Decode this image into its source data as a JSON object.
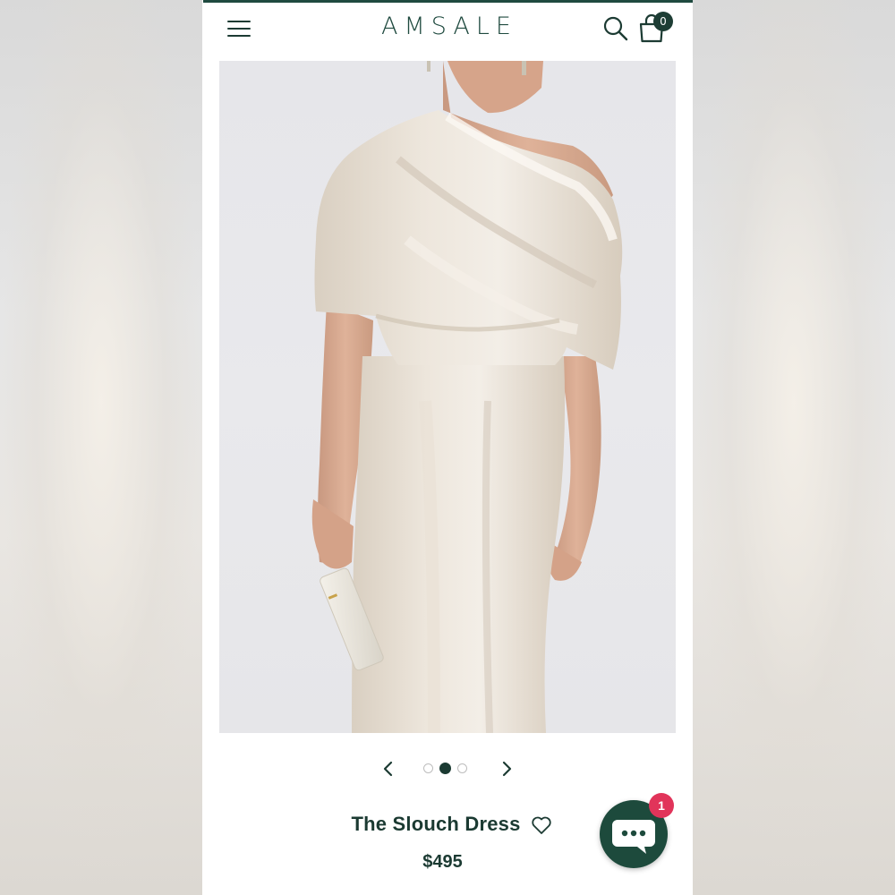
{
  "header": {
    "brand": "AMSALE",
    "cart_count": "0",
    "menu_icon": "hamburger-menu-icon",
    "search_icon": "search-icon",
    "cart_icon": "shopping-bag-icon"
  },
  "product": {
    "title": "The Slouch Dress",
    "price": "$495",
    "image_description_colors": {
      "background": "#e7e7ea",
      "dress": "#e6ddd1",
      "skin": "#d9a98c"
    }
  },
  "carousel": {
    "prev_icon": "chevron-left-icon",
    "next_icon": "chevron-right-icon",
    "total_slides": 3,
    "active_slide": 2
  },
  "chat": {
    "icon": "chat-bubble-icon",
    "badge_count": "1"
  },
  "colors": {
    "brand_green": "#1f4a3f",
    "dark_text": "#1b3a32",
    "badge_red": "#e1345a"
  }
}
